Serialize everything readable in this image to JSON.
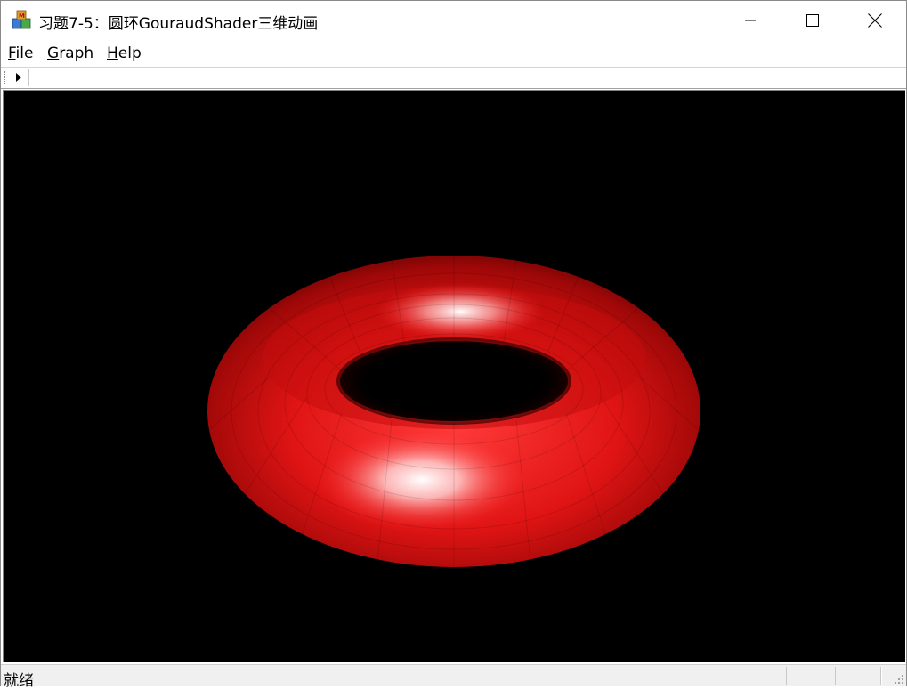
{
  "window": {
    "title": "习题7-5：圆环GouraudShader三维动画"
  },
  "menu": {
    "items": [
      {
        "key": "F",
        "rest": "ile"
      },
      {
        "key": "G",
        "rest": "raph"
      },
      {
        "key": "H",
        "rest": "elp"
      }
    ]
  },
  "toolbar": {
    "play_icon": "play-icon"
  },
  "scene": {
    "background": "#000000",
    "object": "torus",
    "shading": "Gouraud",
    "base_color": "#e01010",
    "highlight_color": "#ffffff"
  },
  "status": {
    "text": "就绪"
  }
}
